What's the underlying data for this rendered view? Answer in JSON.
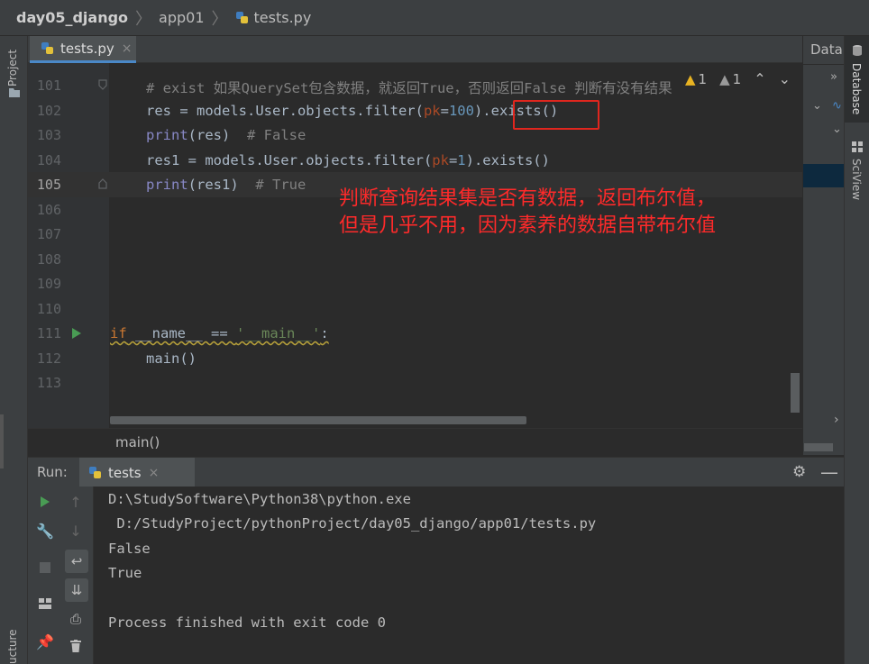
{
  "breadcrumb": {
    "project": "day05_django",
    "folder": "app01",
    "file": "tests.py"
  },
  "editor_tab": {
    "label": "tests.py",
    "close": "×"
  },
  "left_strip": {
    "project": "Project",
    "structure": "ucture"
  },
  "right_strip": {
    "database": "Database",
    "sciview": "SciView"
  },
  "db_panel": {
    "title": "Datab"
  },
  "inspections": {
    "warnings": "1",
    "weak_warnings": "1"
  },
  "line_numbers": [
    "101",
    "102",
    "103",
    "104",
    "105",
    "106",
    "107",
    "108",
    "109",
    "110",
    "111",
    "112",
    "113"
  ],
  "code": {
    "l101": "# exist 如果QuerySet包含数据，就返回True，否则返回False 判断有没有结果",
    "l102_a": "res = models.User.objects.filter(",
    "l102_pk": "pk",
    "l102_eq": "=",
    "l102_num": "100",
    "l102_b": ").exists()",
    "l103_fn": "print",
    "l103_a": "(res)  ",
    "l103_cm": "# False",
    "l104_a": "res1 = models.User.objects.filter(",
    "l104_pk": "pk",
    "l104_eq": "=",
    "l104_num": "1",
    "l104_b": ").exists()",
    "l105_fn": "print",
    "l105_a": "(res1)  ",
    "l105_cm": "# True",
    "l111_if": "if",
    "l111_a": " __name__ == ",
    "l111_str": "'__main__'",
    "l111_b": ":",
    "l112": "main()"
  },
  "annotation": {
    "line1": "判断查询结果集是否有数据，返回布尔值，",
    "line2": "但是几乎不用，因为素养的数据自带布尔值"
  },
  "function_breadcrumb": "main()",
  "run": {
    "label": "Run:",
    "tab": "tests",
    "tab_close": "×",
    "output": [
      "D:\\StudySoftware\\Python38\\python.exe",
      " D:/StudyProject/pythonProject/day05_django/app01/tests.py",
      "False",
      "True",
      "",
      "Process finished with exit code 0"
    ]
  },
  "colors": {
    "background": "#2b2b2b",
    "panel": "#3c3f41",
    "keyword": "#cc7832",
    "comment": "#808080",
    "number": "#6897bb",
    "annotation_red": "#ff2a2a",
    "highlight_box": "#e0261e"
  }
}
